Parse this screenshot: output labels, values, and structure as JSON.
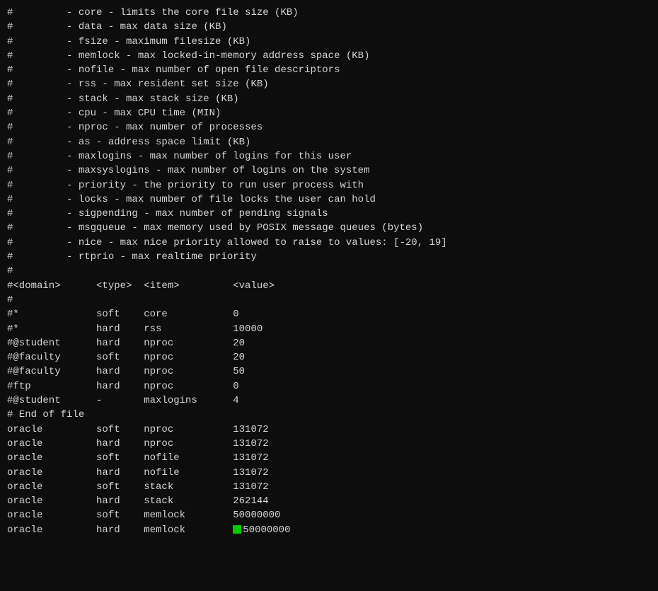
{
  "lines": [
    {
      "text": "#         - core - limits the core file size (KB)",
      "type": "comment"
    },
    {
      "text": "#         - data - max data size (KB)",
      "type": "comment"
    },
    {
      "text": "#         - fsize - maximum filesize (KB)",
      "type": "comment"
    },
    {
      "text": "#         - memlock - max locked-in-memory address space (KB)",
      "type": "comment"
    },
    {
      "text": "#         - nofile - max number of open file descriptors",
      "type": "comment"
    },
    {
      "text": "#         - rss - max resident set size (KB)",
      "type": "comment"
    },
    {
      "text": "#         - stack - max stack size (KB)",
      "type": "comment"
    },
    {
      "text": "#         - cpu - max CPU time (MIN)",
      "type": "comment"
    },
    {
      "text": "#         - nproc - max number of processes",
      "type": "comment"
    },
    {
      "text": "#         - as - address space limit (KB)",
      "type": "comment"
    },
    {
      "text": "#         - maxlogins - max number of logins for this user",
      "type": "comment"
    },
    {
      "text": "#         - maxsyslogins - max number of logins on the system",
      "type": "comment"
    },
    {
      "text": "#         - priority - the priority to run user process with",
      "type": "comment"
    },
    {
      "text": "#         - locks - max number of file locks the user can hold",
      "type": "comment"
    },
    {
      "text": "#         - sigpending - max number of pending signals",
      "type": "comment"
    },
    {
      "text": "#         - msgqueue - max memory used by POSIX message queues (bytes)",
      "type": "comment"
    },
    {
      "text": "#         - nice - max nice priority allowed to raise to values: [-20, 19]",
      "type": "comment"
    },
    {
      "text": "#         - rtprio - max realtime priority",
      "type": "comment"
    },
    {
      "text": "#",
      "type": "comment"
    },
    {
      "text": "#<domain>      <type>  <item>         <value>",
      "type": "comment"
    },
    {
      "text": "#",
      "type": "comment"
    },
    {
      "text": "",
      "type": "blank"
    },
    {
      "text": "#*             soft    core           0",
      "type": "comment"
    },
    {
      "text": "#*             hard    rss            10000",
      "type": "comment"
    },
    {
      "text": "#@student      hard    nproc          20",
      "type": "comment"
    },
    {
      "text": "#@faculty      soft    nproc          20",
      "type": "comment"
    },
    {
      "text": "#@faculty      hard    nproc          50",
      "type": "comment"
    },
    {
      "text": "#ftp           hard    nproc          0",
      "type": "comment"
    },
    {
      "text": "#@student      -       maxlogins      4",
      "type": "comment"
    },
    {
      "text": "",
      "type": "blank"
    },
    {
      "text": "# End of file",
      "type": "comment"
    },
    {
      "text": "oracle         soft    nproc          131072",
      "type": "data"
    },
    {
      "text": "oracle         hard    nproc          131072",
      "type": "data"
    },
    {
      "text": "oracle         soft    nofile         131072",
      "type": "data"
    },
    {
      "text": "oracle         hard    nofile         131072",
      "type": "data"
    },
    {
      "text": "oracle         soft    stack          131072",
      "type": "data"
    },
    {
      "text": "oracle         hard    stack          262144",
      "type": "data"
    },
    {
      "text": "oracle         soft    memlock        50000000",
      "type": "data"
    },
    {
      "text": "oracle         hard    memlock        50000000",
      "type": "data",
      "green": true
    }
  ]
}
